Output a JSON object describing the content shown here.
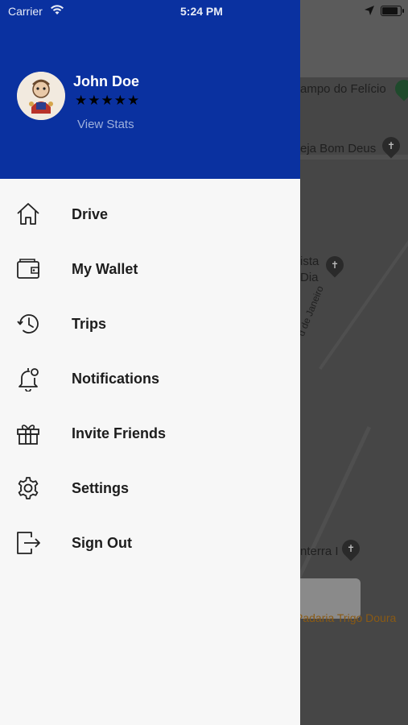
{
  "status_bar": {
    "carrier": "Carrier",
    "time": "5:24 PM",
    "battery_level": 0.9
  },
  "profile": {
    "name": "John Doe",
    "rating_stars": "★★★★★",
    "rating_value": 5,
    "view_stats_label": "View Stats",
    "header_color": "#0a31a0"
  },
  "menu": {
    "items": [
      {
        "label": "Drive",
        "icon": "home-icon"
      },
      {
        "label": "My Wallet",
        "icon": "wallet-icon"
      },
      {
        "label": "Trips",
        "icon": "history-icon"
      },
      {
        "label": "Notifications",
        "icon": "bell-icon"
      },
      {
        "label": "Invite Friends",
        "icon": "gift-icon"
      },
      {
        "label": "Settings",
        "icon": "gear-icon"
      },
      {
        "label": "Sign Out",
        "icon": "sign-out-icon"
      }
    ]
  },
  "map": {
    "labels": [
      "ampo do Felício",
      "eja Bom Deus",
      "ista",
      "Dia",
      "d de Janeiro",
      "nterra I",
      "Padaria Trigo Doura"
    ]
  }
}
